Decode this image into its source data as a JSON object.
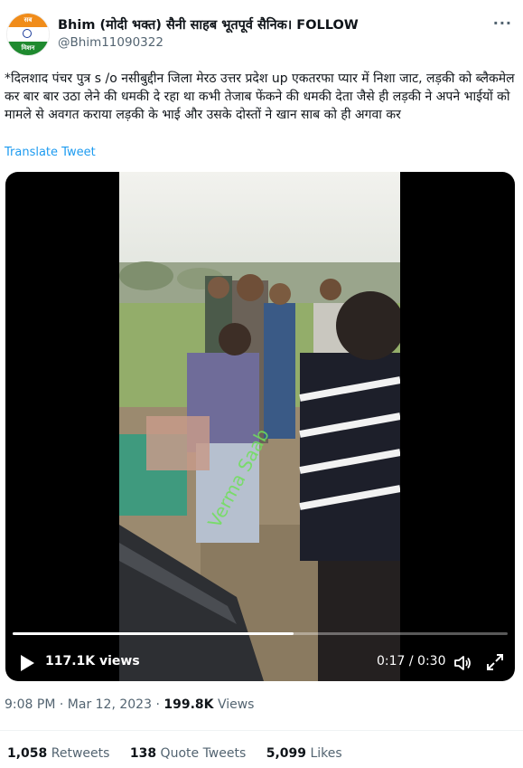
{
  "author": {
    "display_name": "Bhim (मोदी भक्त) सैनी साहब भूतपूर्व सैनिक। FOLLOW",
    "handle": "@Bhim11090322",
    "avatar_text_top": "सब",
    "avatar_text_bottom": "मिशन"
  },
  "more_icon": "ellipsis-icon",
  "tweet_text": "*दिलशाद पंचर पुत्र s /o नसीबुद्दीन जिला मेरठ उत्तर प्रदेश up एकतरफा प्यार में निशा जाट, लड़की को ब्लैकमेल कर बार बार उठा लेने की धमकी दे रहा था कभी तेजाब फेंकने की धमकी देता जैसे ही लड़की ने अपने भाईयों को मामले से अवगत कराया लड़की के भाई और उसके दोस्तों ने खान साब को ही अगवा कर",
  "translate_label": "Translate Tweet",
  "video": {
    "views_label": "117.1K views",
    "time_label": "0:17 / 0:30",
    "progress_fraction": 0.567,
    "watermark": "Verma Saab",
    "icons": [
      "play-icon",
      "volume-icon",
      "fullscreen-icon"
    ]
  },
  "meta": {
    "time": "9:08 PM",
    "separator": " · ",
    "date": "Mar 12, 2023",
    "views_count": "199.8K",
    "views_label": " Views"
  },
  "stats": {
    "retweets_count": "1,058",
    "retweets_label": " Retweets",
    "quotes_count": "138",
    "quotes_label": " Quote Tweets",
    "likes_count": "5,099",
    "likes_label": " Likes"
  },
  "colors": {
    "link": "#1d9bf0",
    "secondary_text": "#536471",
    "primary_text": "#0f1419"
  }
}
